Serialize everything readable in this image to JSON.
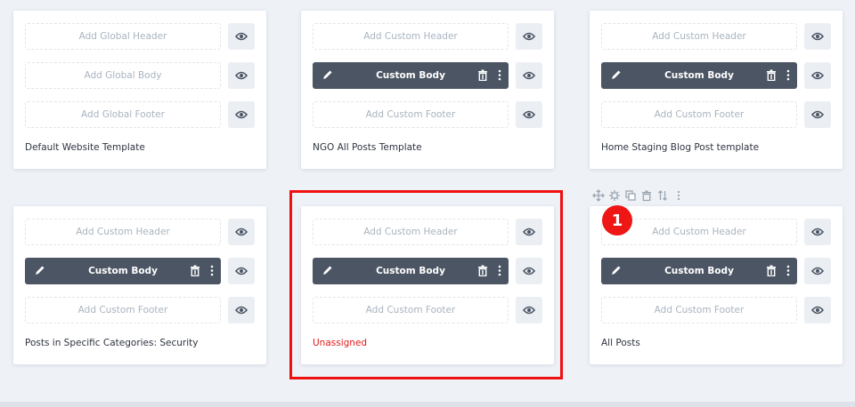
{
  "templates": [
    {
      "name": "Default Website Template",
      "header": {
        "label": "Add Global Header",
        "filled": false
      },
      "body": {
        "label": "Add Global Body",
        "filled": false
      },
      "footer": {
        "label": "Add Global Footer",
        "filled": false
      }
    },
    {
      "name": "NGO All Posts Template",
      "header": {
        "label": "Add Custom Header",
        "filled": false
      },
      "body": {
        "label": "Custom Body",
        "filled": true
      },
      "footer": {
        "label": "Add Custom Footer",
        "filled": false
      }
    },
    {
      "name": "Home Staging Blog Post template",
      "header": {
        "label": "Add Custom Header",
        "filled": false
      },
      "body": {
        "label": "Custom Body",
        "filled": true
      },
      "footer": {
        "label": "Add Custom Footer",
        "filled": false
      }
    },
    {
      "name": "Posts in Specific Categories: Security",
      "header": {
        "label": "Add Custom Header",
        "filled": false
      },
      "body": {
        "label": "Custom Body",
        "filled": true
      },
      "footer": {
        "label": "Add Custom Footer",
        "filled": false
      }
    },
    {
      "name": "Unassigned",
      "header": {
        "label": "Add Custom Header",
        "filled": false
      },
      "body": {
        "label": "Custom Body",
        "filled": true
      },
      "footer": {
        "label": "Add Custom Footer",
        "filled": false
      }
    },
    {
      "name": "All Posts",
      "header": {
        "label": "Add Custom Header",
        "filled": false
      },
      "body": {
        "label": "Custom Body",
        "filled": true
      },
      "footer": {
        "label": "Add Custom Footer",
        "filled": false
      }
    }
  ],
  "annotation": {
    "badge_number": "1",
    "highlight_color": "#ef1010"
  },
  "colors": {
    "filled_slot": "#4b5563",
    "unassigned_title": "#e21a1a",
    "empty_slot_text": "#a9b4c0",
    "background": "#eef1f6"
  },
  "icons": {
    "edit": "pencil-icon",
    "delete": "trash-icon",
    "more": "more-vertical-icon",
    "visibility": "eye-icon",
    "toolbar": [
      "move-icon",
      "gear-icon",
      "duplicate-icon",
      "trash-icon",
      "sort-icon",
      "more-vertical-icon"
    ]
  }
}
